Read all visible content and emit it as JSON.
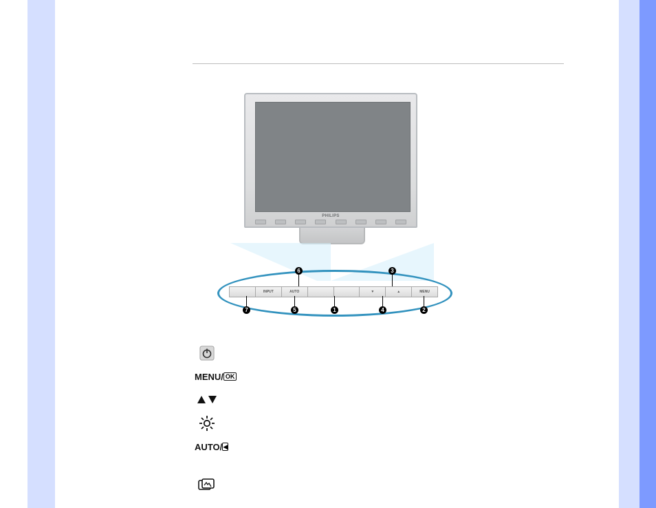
{
  "brand": "PHILIPS",
  "panel": {
    "segments": [
      "",
      "INPUT",
      "AUTO",
      "",
      "",
      "▼",
      "▲",
      "MENU"
    ]
  },
  "callouts": {
    "top": [
      {
        "n": "6"
      },
      {
        "n": "3"
      }
    ],
    "bottom": [
      {
        "n": "7"
      },
      {
        "n": "5"
      },
      {
        "n": "1"
      },
      {
        "n": "4"
      },
      {
        "n": "2"
      }
    ]
  },
  "legend": [
    {
      "id": 1,
      "icon": "power",
      "label": ""
    },
    {
      "id": 2,
      "icon": "menu-ok",
      "label": "MENU/"
    },
    {
      "id": 3,
      "icon": "up-down",
      "label": ""
    },
    {
      "id": 4,
      "icon": "brightness",
      "label": ""
    },
    {
      "id": 5,
      "icon": "auto-back",
      "label": "AUTO/"
    },
    {
      "id": 6,
      "icon": "",
      "label": ""
    },
    {
      "id": 7,
      "icon": "smartimage",
      "label": ""
    }
  ]
}
